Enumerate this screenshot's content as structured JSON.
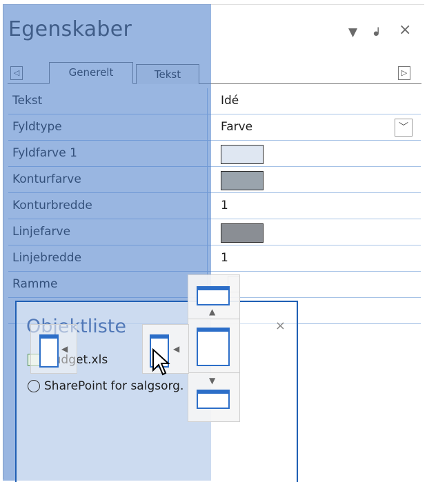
{
  "panel": {
    "title": "Egenskaber",
    "controls": {
      "dropdown": "▼",
      "pin": "ᖱ",
      "close": "×"
    }
  },
  "tabs": {
    "scroll_left": "◁",
    "scroll_right": "▷",
    "items": [
      {
        "label": "Generelt",
        "active": true
      },
      {
        "label": "Tekst",
        "active": false
      }
    ]
  },
  "properties": [
    {
      "name": "Tekst",
      "value": "Idé",
      "kind": "text"
    },
    {
      "name": "Fyldtype",
      "value": "Farve",
      "kind": "dropdown"
    },
    {
      "name": "Fyldfarve 1",
      "value": "",
      "kind": "color",
      "color": "#dfe7f2"
    },
    {
      "name": "Konturfarve",
      "value": "",
      "kind": "color",
      "color": "#9aa4ad"
    },
    {
      "name": "Konturbredde",
      "value": "1",
      "kind": "text"
    },
    {
      "name": "Linjefarve",
      "value": "",
      "kind": "color",
      "color": "#8a8e94"
    },
    {
      "name": "Linjebredde",
      "value": "1",
      "kind": "text"
    },
    {
      "name": "Ramme",
      "value": "",
      "kind": "checkbox"
    }
  ],
  "object_list": {
    "title": "Objektliste",
    "close": "×",
    "items": [
      {
        "label": "Budget.xls",
        "icon": "excel-file-icon"
      },
      {
        "label": "SharePoint for salgsorg.",
        "icon": "sharepoint-globe-icon"
      }
    ]
  },
  "colors": {
    "accent": "#2c6ec8",
    "overlay": "#467ac8",
    "grid_line": "#a6c2e6"
  }
}
